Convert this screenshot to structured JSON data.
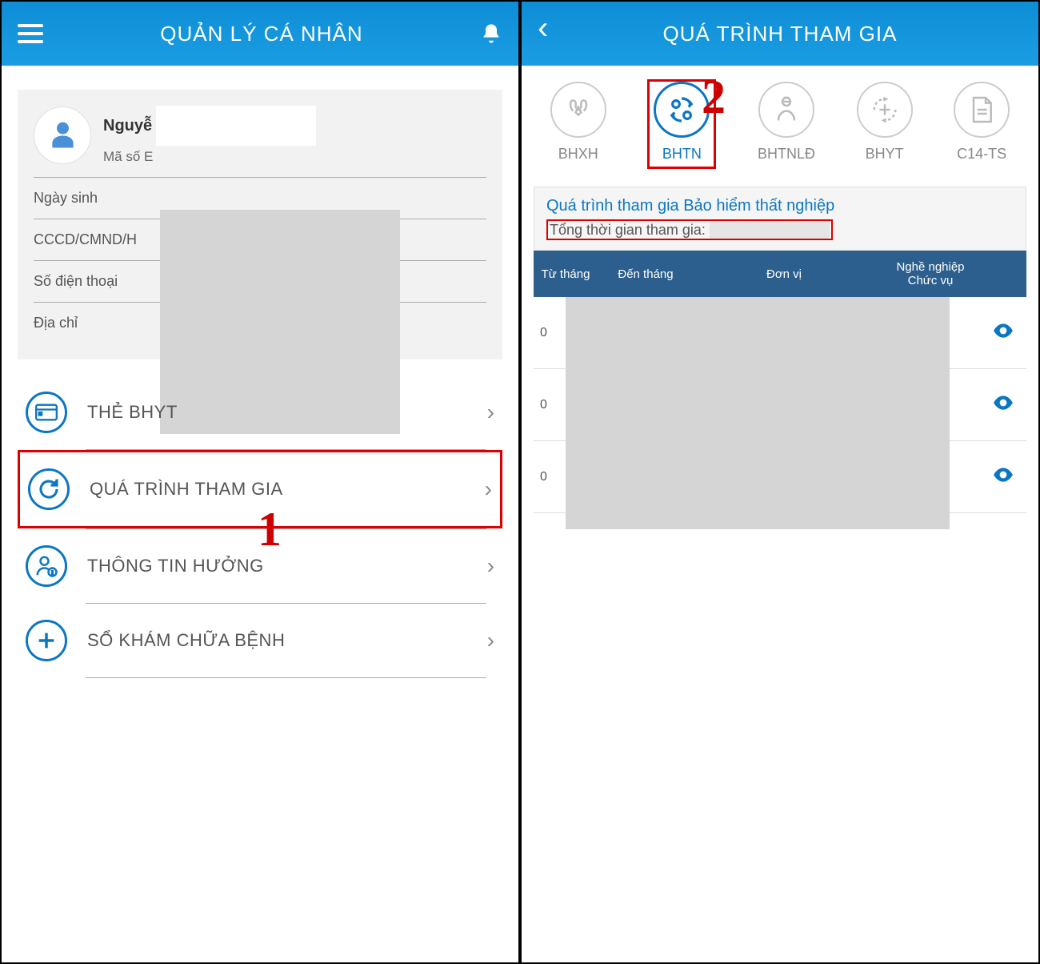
{
  "screen1": {
    "title": "QUẢN LÝ CÁ NHÂN",
    "profile": {
      "name_prefix": "Nguyễ",
      "id_label": "Mã số E",
      "rows": [
        {
          "label": "Ngày sinh"
        },
        {
          "label": "CCCD/CMND/H"
        },
        {
          "label": "Số điện thoại"
        },
        {
          "label": "Địa chỉ"
        }
      ]
    },
    "menu": [
      {
        "label": "THẺ BHYT",
        "icon": "card"
      },
      {
        "label": "QUÁ TRÌNH THAM GIA",
        "icon": "refresh",
        "highlighted": true
      },
      {
        "label": "THÔNG TIN HƯỞNG",
        "icon": "person"
      },
      {
        "label": "SỔ KHÁM CHỮA BỆNH",
        "icon": "plus"
      }
    ],
    "annotation": "1"
  },
  "screen2": {
    "title": "QUÁ TRÌNH THAM GIA",
    "tabs": [
      {
        "label": "BHXH",
        "icon": "hands"
      },
      {
        "label": "BHTN",
        "icon": "people",
        "active": true,
        "highlighted": true
      },
      {
        "label": "BHTNLĐ",
        "icon": "worker"
      },
      {
        "label": "BHYT",
        "icon": "medical"
      },
      {
        "label": "C14-TS",
        "icon": "doc"
      }
    ],
    "section": {
      "title": "Quá trình tham gia Bảo hiểm thất nghiệp",
      "subtitle": "Tổng thời gian tham gia:"
    },
    "table": {
      "headers": {
        "from": "Từ tháng",
        "to": "Đến tháng",
        "unit": "Đơn vị",
        "job": "Nghề nghiệp Chức vụ"
      },
      "rows": [
        {
          "from": "0"
        },
        {
          "from": "0"
        },
        {
          "from": "0"
        }
      ]
    },
    "annotation": "2"
  }
}
